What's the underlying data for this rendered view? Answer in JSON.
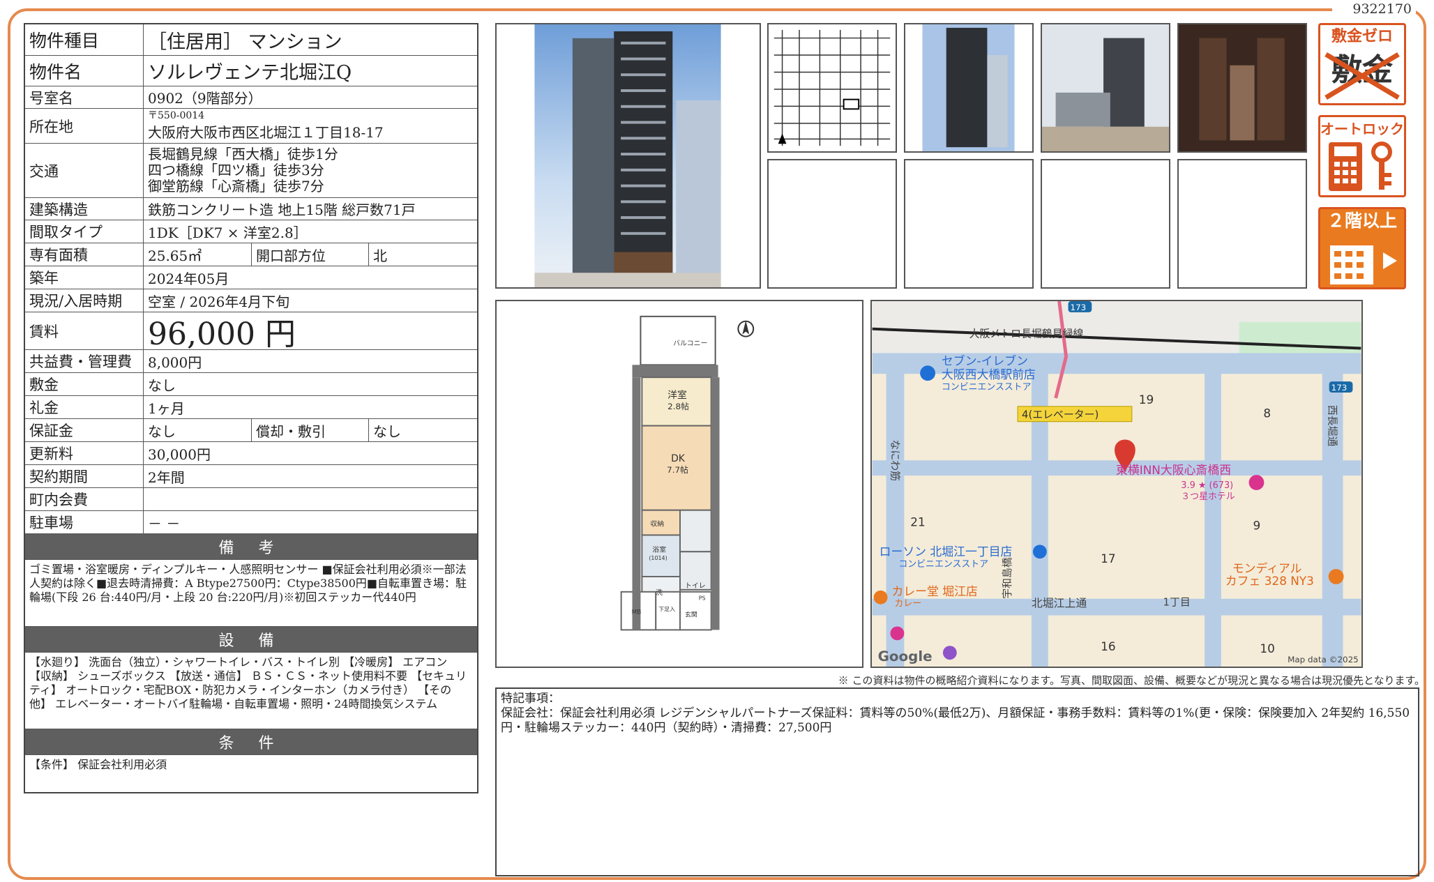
{
  "doc_number": "9322170",
  "spec": {
    "type_label": "物件種目",
    "type_value": "［住居用］ マンション",
    "name_label": "物件名",
    "name_value": "ソルレヴェンテ北堀江Q",
    "room_label": "号室名",
    "room_value": "0902（9階部分）",
    "address_label": "所在地",
    "postal": "〒550-0014",
    "address_value": "大阪府大阪市西区北堀江１丁目18-17",
    "access_label": "交通",
    "access": [
      "長堀鶴見線「西大橋」徒歩1分",
      "四つ橋線「四ツ橋」徒歩3分",
      "御堂筋線「心斎橋」徒歩7分"
    ],
    "structure_label": "建築構造",
    "structure_value": "鉄筋コンクリート造 地上15階 総戸数71戸",
    "layout_label": "間取タイプ",
    "layout_value": "1DK［DK7 × 洋室2.8］",
    "area_label": "専有面積",
    "area_value": "25.65㎡",
    "facing_label": "開口部方位",
    "facing_value": "北",
    "built_label": "築年",
    "built_value": "2024年05月",
    "status_label": "現況/入居時期",
    "status_value": "空室 / 2026年4月下旬",
    "rent_label": "賃料",
    "rent_value": "96,000 円",
    "fee_label": "共益費・管理費",
    "fee_value": "8,000円",
    "shikikin_label": "敷金",
    "shikikin_value": "なし",
    "reikin_label": "礼金",
    "reikin_value": "1ヶ月",
    "deposit_label": "保証金",
    "deposit_value": "なし",
    "amort_label": "償却・敷引",
    "amort_value": "なし",
    "renewal_label": "更新料",
    "renewal_value": "30,000円",
    "contract_label": "契約期間",
    "contract_value": "2年間",
    "town_label": "町内会費",
    "town_value": "",
    "parking_label": "駐車場",
    "parking_value": "－ －"
  },
  "remarks": {
    "heading": "備 考",
    "text": "ゴミ置場・浴室暖房・ディンプルキー・人感照明センサー ■保証会社利用必須※一部法人契約は除く■退去時清掃費：A Btype27500円：Ctype38500円■自転車置き場：駐輪場(下段 26 台:440円/月・上段 20 台:220円/月)※初回ステッカー代440円"
  },
  "facilities": {
    "heading": "設 備",
    "text": "【水廻り】 洗面台（独立）・シャワートイレ・バス・トイレ別 【冷暖房】 エアコン 【収納】 シューズボックス 【放送・通信】 ＢＳ・ＣＳ・ネット使用料不要 【セキュリティ】 オートロック・宅配BOX・防犯カメラ・インターホン（カメラ付き） 【その他】 エレベーター・オートバイ駐輪場・自転車置場・照明・24時間換気システム"
  },
  "conditions": {
    "heading": "条 件",
    "text": "【条件】 保証会社利用必須"
  },
  "badges": {
    "b1": "敷金ゼロ",
    "b1_strike": "敷金",
    "b2": "オートロック",
    "b3": "２階以上"
  },
  "floorplan": {
    "balcony": "バルコニー",
    "western_room": "洋室",
    "western_size": "2.8帖",
    "dk": "DK",
    "dk_size": "7.7帖",
    "storage": "収納",
    "bath": "浴室",
    "bath_size": "(1014)",
    "wash": "洗",
    "toilet": "トイレ",
    "shoe": "下足入",
    "mb": "MB",
    "ps": "PS",
    "entrance": "玄関"
  },
  "map": {
    "route_badge": "173",
    "rail_line": "大阪メトロ長堀鶴見緑線",
    "store1_name": "セブン-イレブン",
    "store1_branch": "大阪西大橋駅前店",
    "store1_type": "コンビニエンスストア",
    "elevator": "4(エレベーター)",
    "block19": "19",
    "block8": "8",
    "block21": "21",
    "block9": "9",
    "block17": "17",
    "block16": "16",
    "block10": "10",
    "hotel_name": "東横INN大阪心斎橋西",
    "hotel_rating": "3.9 ★ (673)",
    "hotel_type": "３つ星ホテル",
    "store2_name": "ローソン 北堀江一丁目店",
    "store2_type": "コンビニエンスストア",
    "curry_name": "カレー堂 堀江店",
    "curry_type": "カレー",
    "cafe_name": "モンディアル",
    "cafe_branch": "カフェ 328 NY3",
    "street1": "北堀江上通",
    "chome": "1丁目",
    "road_v1": "なにわ筋",
    "road_v2": "西長堀通",
    "road_v3": "宇和島橋",
    "google": "Google",
    "mapdata": "Map data ©2025"
  },
  "disclaimer": "※ この資料は物件の概略紹介資料になります。写真、間取図面、設備、概要などが現況と異なる場合は現況優先となります。",
  "notes": {
    "title": "特記事項：",
    "text": "保証会社：保証会社利用必須 レジデンシャルパートナーズ保証料：賃料等の50%(最低2万)、月額保証・事務手数料：賃料等の1%(更・保険：保険要加入 2年契約 16,550円・駐輪場ステッカー：440円（契約時）・清掃費：27,500円"
  },
  "colors": {
    "frame": "#e58a4e",
    "badge_red": "#d9531f",
    "badge_orange": "#ea7a1f",
    "header_gray": "#5f5f5f"
  }
}
